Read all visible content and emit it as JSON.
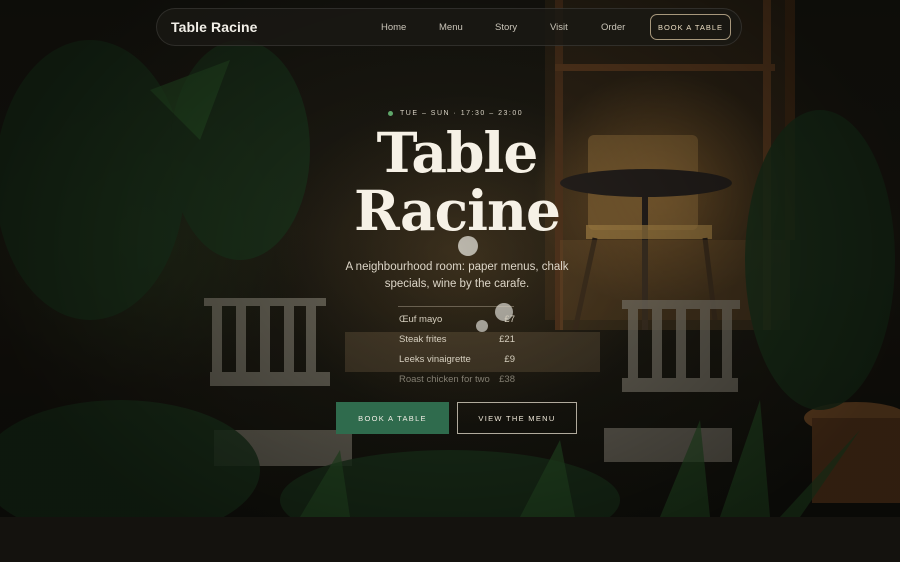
{
  "nav": {
    "brand": "Table Racine",
    "links": [
      "Home",
      "Menu",
      "Story",
      "Visit",
      "Order"
    ],
    "cta": "BOOK A TABLE"
  },
  "hero": {
    "hours": "TUE – SUN · 17:30 – 23:00",
    "status_color": "#5fa66a",
    "title_line1": "Table",
    "title_line2": "Racine",
    "tagline": "A neighbourhood room: paper menus, chalk specials, wine by the carafe.",
    "menu": [
      {
        "name": "Œuf mayo",
        "price": "£7"
      },
      {
        "name": "Steak frites",
        "price": "£21"
      },
      {
        "name": "Leeks vinaigrette",
        "price": "£9"
      },
      {
        "name": "Roast chicken for two",
        "price": "£38"
      }
    ],
    "primary_button": "BOOK A TABLE",
    "secondary_button": "VIEW THE MENU",
    "accent_color": "#2f6b4d"
  }
}
